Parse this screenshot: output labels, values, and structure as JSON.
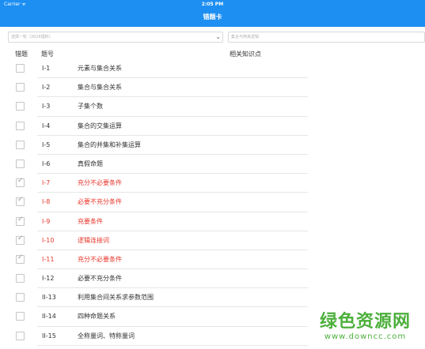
{
  "status_bar": {
    "carrier": "Carrier ᯤ",
    "time": "2:05 PM"
  },
  "header": {
    "title": "错题卡"
  },
  "filters": {
    "exam_select": "选择一轮（2016理科）",
    "search_placeholder": "集合与简易逻辑"
  },
  "columns": {
    "error": "错题",
    "number": "题号",
    "knowledge": "相关知识点"
  },
  "rows": [
    {
      "num": "I-1",
      "name": "元素与集合关系",
      "checked": false
    },
    {
      "num": "I-2",
      "name": "集合与集合关系",
      "checked": false
    },
    {
      "num": "I-3",
      "name": "子集个数",
      "checked": false
    },
    {
      "num": "I-4",
      "name": "集合的交集运算",
      "checked": false
    },
    {
      "num": "I-5",
      "name": "集合的并集和补集运算",
      "checked": false
    },
    {
      "num": "I-6",
      "name": "真假命题",
      "checked": false
    },
    {
      "num": "I-7",
      "name": "充分不必要条件",
      "checked": true
    },
    {
      "num": "I-8",
      "name": "必要不充分条件",
      "checked": true
    },
    {
      "num": "I-9",
      "name": "充要条件",
      "checked": true
    },
    {
      "num": "I-10",
      "name": "逻辑连接词",
      "checked": true
    },
    {
      "num": "I-11",
      "name": "充分不必要条件",
      "checked": true
    },
    {
      "num": "I-12",
      "name": "必要不充分条件",
      "checked": false
    },
    {
      "num": "II-13",
      "name": "利用集合间关系求参数范围",
      "checked": false
    },
    {
      "num": "II-14",
      "name": "四种命题关系",
      "checked": false
    },
    {
      "num": "II-15",
      "name": "全称量词、特称量词",
      "checked": false
    }
  ],
  "watermark": {
    "text": "绿色资源网",
    "url": "www.downcc.com"
  }
}
